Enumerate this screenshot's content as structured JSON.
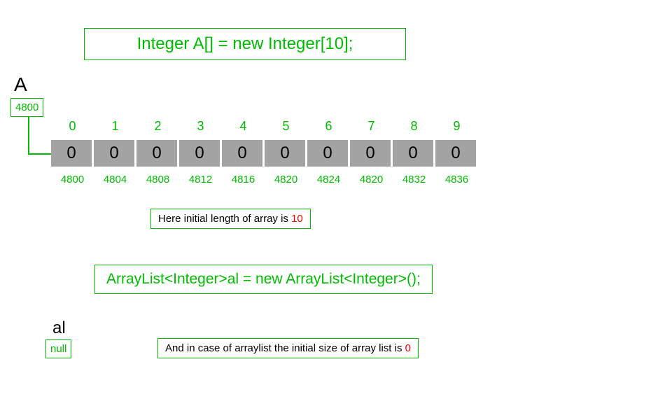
{
  "code1": "Integer A[] = new Integer[10];",
  "labelA": "A",
  "ptrA": "4800",
  "indices": [
    "0",
    "1",
    "2",
    "3",
    "4",
    "5",
    "6",
    "7",
    "8",
    "9"
  ],
  "cells": [
    "0",
    "0",
    "0",
    "0",
    "0",
    "0",
    "0",
    "0",
    "0",
    "0"
  ],
  "addresses": [
    "4800",
    "4804",
    "4808",
    "4812",
    "4816",
    "4820",
    "4824",
    "4820",
    "4832",
    "4836"
  ],
  "note1_prefix": "Here initial length of array  is ",
  "note1_value": "10",
  "code2": "ArrayList<Integer>al = new ArrayList<Integer>();",
  "label_al": "al",
  "ptr_al": "null",
  "note2_prefix": "And in case of arraylist the initial size of array list is ",
  "note2_value": "0",
  "chart_data": {
    "type": "table",
    "title": "Java Integer array vs ArrayList initial state",
    "arrays": [
      {
        "name": "A",
        "declaration": "Integer A[] = new Integer[10];",
        "pointer_value": 4800,
        "length": 10,
        "indices": [
          0,
          1,
          2,
          3,
          4,
          5,
          6,
          7,
          8,
          9
        ],
        "values": [
          0,
          0,
          0,
          0,
          0,
          0,
          0,
          0,
          0,
          0
        ],
        "addresses": [
          4800,
          4804,
          4808,
          4812,
          4816,
          4820,
          4824,
          4820,
          4832,
          4836
        ]
      },
      {
        "name": "al",
        "declaration": "ArrayList<Integer>al = new ArrayList<Integer>();",
        "pointer_value": "null",
        "length": 0
      }
    ]
  }
}
